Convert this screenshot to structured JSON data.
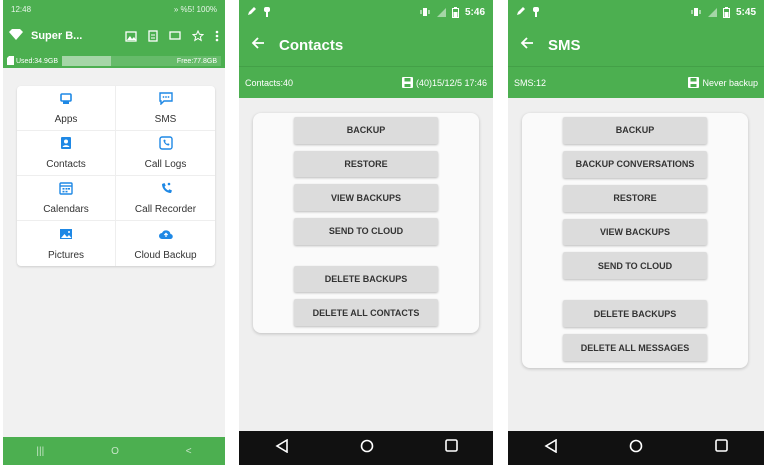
{
  "phone1": {
    "status": {
      "time": "12:48",
      "right": "» %5! 100%"
    },
    "app_title": "Super B...",
    "storage": {
      "used": "Used:34.9GB",
      "free": "Free:77.8GB",
      "used_fraction": 0.31
    },
    "grid": [
      {
        "label": "Apps",
        "icon": "apps-icon"
      },
      {
        "label": "SMS",
        "icon": "sms-icon"
      },
      {
        "label": "Contacts",
        "icon": "contacts-icon"
      },
      {
        "label": "Call Logs",
        "icon": "call-logs-icon"
      },
      {
        "label": "Calendars",
        "icon": "calendar-icon"
      },
      {
        "label": "Call Recorder",
        "icon": "call-recorder-icon"
      },
      {
        "label": "Pictures",
        "icon": "pictures-icon"
      },
      {
        "label": "Cloud Backup",
        "icon": "cloud-backup-icon"
      }
    ],
    "nav": {
      "recents": "|||",
      "home": "O",
      "back": "<"
    }
  },
  "phone2": {
    "status_time": "5:46",
    "title": "Contacts",
    "info_left": "Contacts:40",
    "info_right": "(40)15/12/5 17:46",
    "buttons": [
      "BACKUP",
      "RESTORE",
      "VIEW BACKUPS",
      "SEND TO CLOUD"
    ],
    "danger_buttons": [
      "DELETE BACKUPS",
      "DELETE ALL CONTACTS"
    ]
  },
  "phone3": {
    "status_time": "5:45",
    "title": "SMS",
    "info_left": "SMS:12",
    "info_right": "Never backup",
    "buttons": [
      "BACKUP",
      "BACKUP CONVERSATIONS",
      "RESTORE",
      "VIEW BACKUPS",
      "SEND TO CLOUD"
    ],
    "danger_buttons": [
      "DELETE BACKUPS",
      "DELETE ALL MESSAGES"
    ]
  },
  "colors": {
    "accent": "#4caf50",
    "button": "#dcdcdc",
    "navbar": "#111111"
  }
}
